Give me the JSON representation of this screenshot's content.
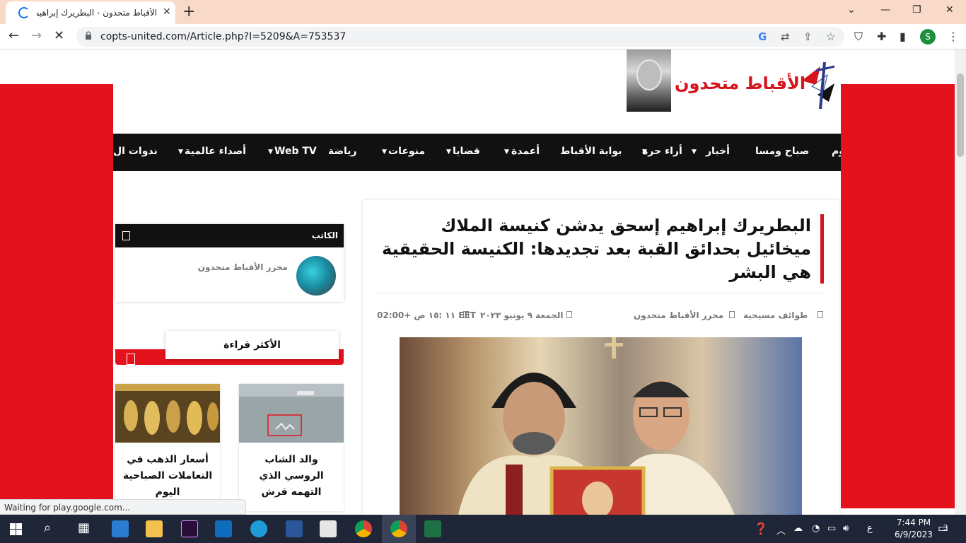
{
  "browser": {
    "tab_title": "الأقباط متحدون - البطريرك إبراهيم إسحق",
    "url": "copts-united.com/Article.php?I=5209&A=753537",
    "profile_letter": "S",
    "status_text": "Waiting for play.google.com..."
  },
  "site": {
    "logo_text": "الأقباط متحدون"
  },
  "nav": {
    "items": [
      "يوم",
      "صباح ومسا",
      "أخبار",
      "أراء حرة",
      "بوابة الأقباط",
      "أعمدة",
      "قضايا",
      "منوعات",
      "رياضة",
      "Web TV",
      "أصداء عالمية",
      "ندوات ال"
    ]
  },
  "article": {
    "title": "البطريرك إبراهيم إسحق يدشن كنيسة الملاك ميخائيل بحدائق القبة بعد تجديدها: الكنيسة الحقيقية هي البشر",
    "category": "طوائف مسيحية",
    "author": "محرر الأقباط متحدون",
    "date": "الجمعة ٩ يونيو ٢٠٢٣",
    "time": "١١ :١٥ ص +02:00 EET"
  },
  "sidebar": {
    "author_label": "الكاتب",
    "author_name": "محرر الأقباط متحدون",
    "most_read_label": "الأكثر قراءة",
    "news": [
      {
        "text": "والد الشاب الروسي الذي التهمه قرش"
      },
      {
        "text": "أسعار الذهب في التعاملات الصباحية اليوم"
      }
    ]
  },
  "taskbar": {
    "time": "7:44 PM",
    "date": "6/9/2023",
    "lang": "ع",
    "notifications": "3"
  },
  "colors": {
    "brand_red": "#e4121c",
    "nav_bg": "#111111",
    "tab_strip": "#f9d9c8"
  }
}
